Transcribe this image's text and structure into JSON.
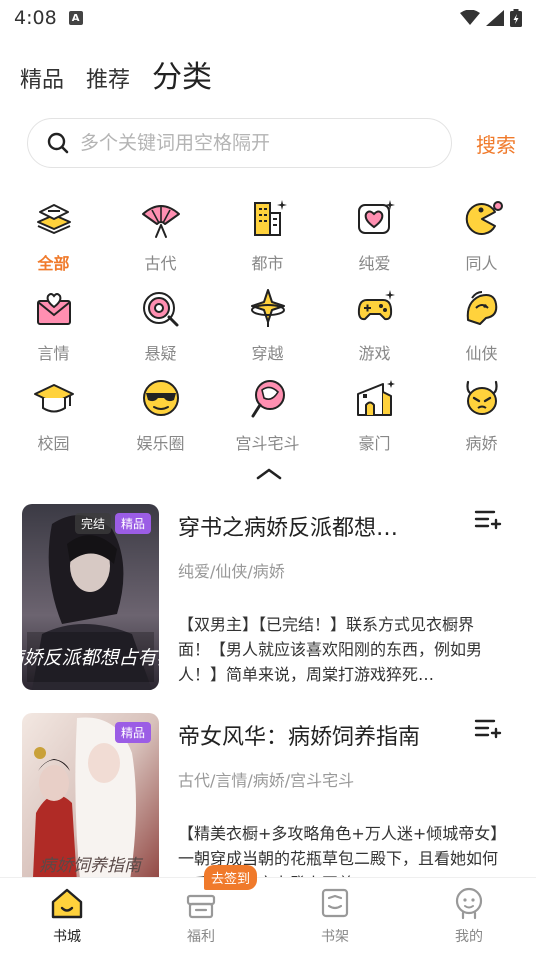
{
  "status": {
    "time": "4:08",
    "notif_letter": "A"
  },
  "top_tabs": [
    {
      "label": "精品",
      "active": false
    },
    {
      "label": "推荐",
      "active": false
    },
    {
      "label": "分类",
      "active": true
    }
  ],
  "search": {
    "placeholder": "多个关键词用空格隔开",
    "button": "搜索"
  },
  "categories": [
    {
      "label": "全部",
      "icon": "books-icon",
      "active": true
    },
    {
      "label": "古代",
      "icon": "fan-icon"
    },
    {
      "label": "都市",
      "icon": "city-icon"
    },
    {
      "label": "纯爱",
      "icon": "heart-frame-icon"
    },
    {
      "label": "同人",
      "icon": "pacman-icon"
    },
    {
      "label": "言情",
      "icon": "love-letter-icon"
    },
    {
      "label": "悬疑",
      "icon": "target-icon"
    },
    {
      "label": "穿越",
      "icon": "portal-star-icon"
    },
    {
      "label": "游戏",
      "icon": "gamepad-icon"
    },
    {
      "label": "仙侠",
      "icon": "fox-icon"
    },
    {
      "label": "校园",
      "icon": "grad-cap-icon"
    },
    {
      "label": "娱乐圈",
      "icon": "sunglasses-icon"
    },
    {
      "label": "宫斗宅斗",
      "icon": "round-fan-icon"
    },
    {
      "label": "豪门",
      "icon": "mansion-icon"
    },
    {
      "label": "病娇",
      "icon": "devil-icon"
    }
  ],
  "books": [
    {
      "title": "穿书之病娇反派都想…",
      "tags": "纯爱/仙侠/病娇",
      "desc": "【双男主】【已完结！】联系方式见衣橱界面！【男人就应该喜欢阳刚的东西，例如男人！】简单来说，周棠打游戏猝死…",
      "badges": [
        "完结",
        "精品"
      ],
      "cover_text": "病娇反派都想占有我"
    },
    {
      "title": "帝女风华：病娇饲养指南",
      "tags": "古代/言情/病娇/宫斗宅斗",
      "desc": "【精美衣橱+多攻略角色+万人迷+倾城帝女】一朝穿成当朝的花瓶草包二殿下，且看她如何一手为王任宰力登上至尊…",
      "badges": [
        "精品"
      ],
      "cover_text": "病娇饲养指南"
    }
  ],
  "bottom_nav": {
    "items": [
      {
        "label": "书城",
        "icon": "home-icon",
        "active": true
      },
      {
        "label": "福利",
        "icon": "gift-icon"
      },
      {
        "label": "书架",
        "icon": "bookshelf-icon"
      },
      {
        "label": "我的",
        "icon": "profile-icon"
      }
    ],
    "signin_badge": "去签到"
  },
  "colors": {
    "accent": "#f07a2b",
    "badge_purple": "#9b5de5",
    "icon_yellow": "#ffd23c",
    "icon_pink": "#ff8fb1"
  }
}
